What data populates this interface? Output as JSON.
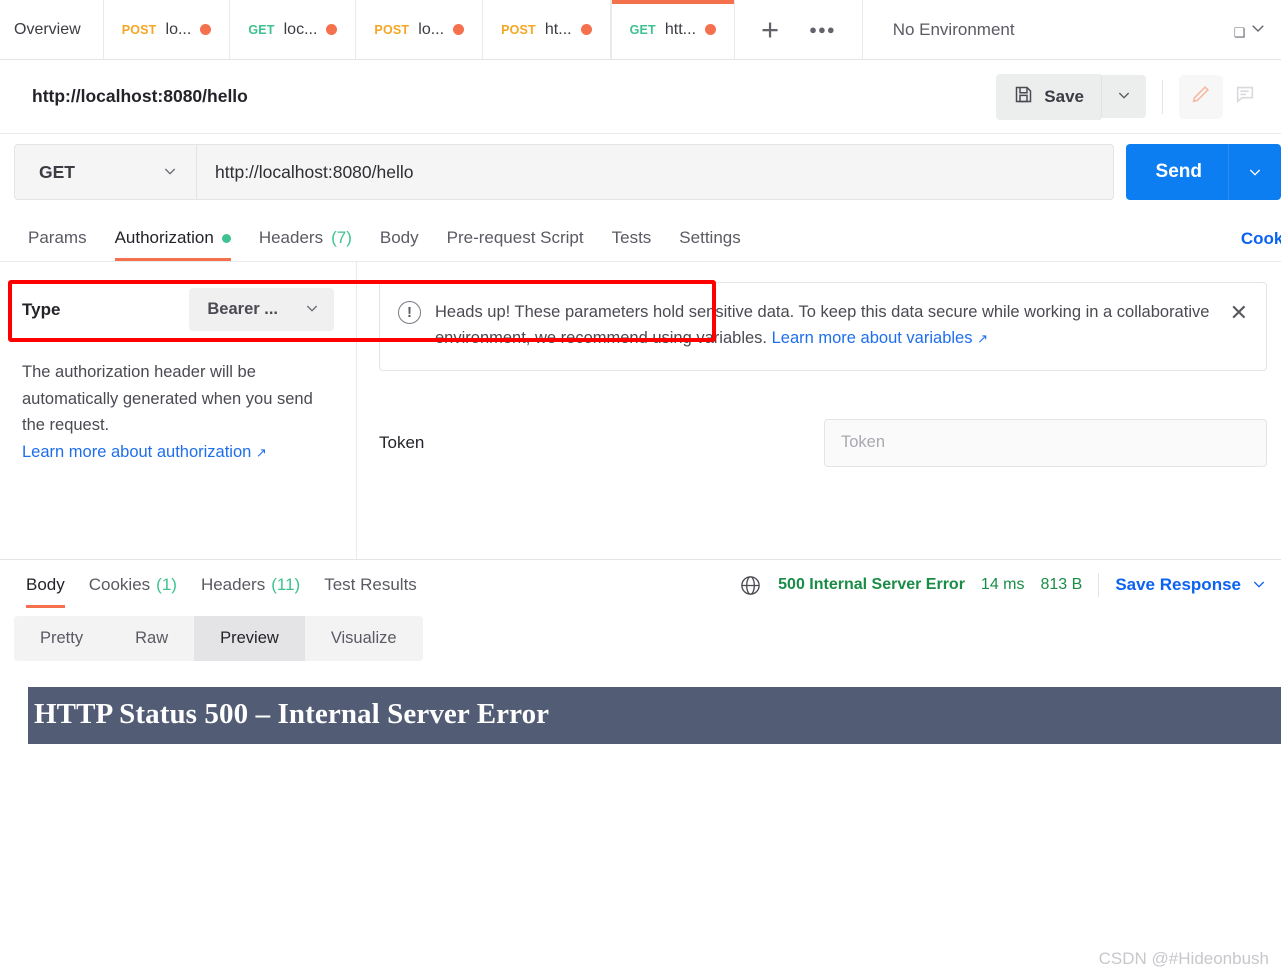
{
  "tabbar": {
    "overview_label": "Overview",
    "tabs": [
      {
        "method": "POST",
        "label": "lo...",
        "dirty": true,
        "active": false
      },
      {
        "method": "GET",
        "label": "loc...",
        "dirty": true,
        "active": false
      },
      {
        "method": "POST",
        "label": "lo...",
        "dirty": true,
        "active": false
      },
      {
        "method": "POST",
        "label": "ht...",
        "dirty": true,
        "active": false
      },
      {
        "method": "GET",
        "label": "htt...",
        "dirty": true,
        "active": true
      }
    ],
    "new_tab_icon": "plus-icon",
    "more_icon": "ellipsis-icon",
    "environment": "No Environment",
    "environment_caret": "chevron-down-icon"
  },
  "titlebar": {
    "request_title": "http://localhost:8080/hello",
    "save_label": "Save",
    "save_icon": "floppy-disk-icon",
    "save_caret_icon": "chevron-down-icon",
    "edit_icon": "pencil-icon",
    "comment_icon": "comment-icon"
  },
  "urlbar": {
    "method": "GET",
    "method_caret_icon": "chevron-down-icon",
    "url": "http://localhost:8080/hello",
    "send_label": "Send",
    "send_caret_icon": "chevron-down-icon",
    "annotation_color": "#fe0000"
  },
  "request_tabs": {
    "items": [
      {
        "label": "Params",
        "badge": "",
        "dot": false,
        "active": false
      },
      {
        "label": "Authorization",
        "badge": "",
        "dot": true,
        "active": true
      },
      {
        "label": "Headers",
        "badge": "(7)",
        "dot": false,
        "active": false
      },
      {
        "label": "Body",
        "badge": "",
        "dot": false,
        "active": false
      },
      {
        "label": "Pre-request Script",
        "badge": "",
        "dot": false,
        "active": false
      },
      {
        "label": "Tests",
        "badge": "",
        "dot": false,
        "active": false
      },
      {
        "label": "Settings",
        "badge": "",
        "dot": false,
        "active": false
      }
    ],
    "cookies_label": "Cookies"
  },
  "auth": {
    "type_label": "Type",
    "type_value": "Bearer ...",
    "type_caret_icon": "chevron-down-icon",
    "description": "The authorization header will be automatically generated when you send the request.",
    "learn_more_label": "Learn more about authorization",
    "learn_more_arrow": "↗",
    "notice": {
      "icon": "exclamation-circle-icon",
      "text": "Heads up! These parameters hold sensitive data. To keep this data secure while working in a collaborative environment, we recommend using variables.",
      "link_label": "Learn more about variables",
      "link_arrow": "↗",
      "close_icon": "close-icon"
    },
    "token_label": "Token",
    "token_value": "",
    "token_placeholder": "Token"
  },
  "response": {
    "tabs": [
      {
        "label": "Body",
        "badge": "",
        "active": true
      },
      {
        "label": "Cookies",
        "badge": "(1)",
        "active": false
      },
      {
        "label": "Headers",
        "badge": "(11)",
        "active": false
      },
      {
        "label": "Test Results",
        "badge": "",
        "active": false
      }
    ],
    "globe_icon": "globe-icon",
    "status": "500 Internal Server Error",
    "time": "14 ms",
    "size": "813 B",
    "save_response_label": "Save Response",
    "save_response_caret_icon": "chevron-down-icon",
    "view_modes": [
      {
        "label": "Pretty",
        "active": false
      },
      {
        "label": "Raw",
        "active": false
      },
      {
        "label": "Preview",
        "active": true
      },
      {
        "label": "Visualize",
        "active": false
      }
    ],
    "preview_banner_text": "HTTP Status 500 – Internal Server Error",
    "preview_banner_color": "#525d75"
  },
  "watermark": "CSDN @#Hideonbush"
}
